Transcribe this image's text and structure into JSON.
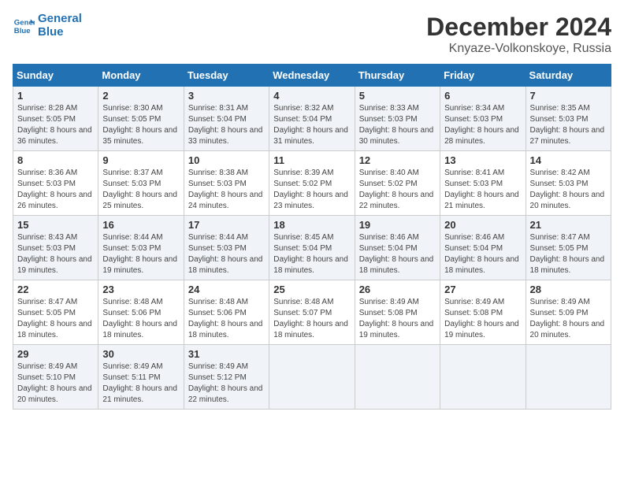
{
  "logo": {
    "line1": "General",
    "line2": "Blue"
  },
  "title": "December 2024",
  "location": "Knyaze-Volkonskoye, Russia",
  "days_of_week": [
    "Sunday",
    "Monday",
    "Tuesday",
    "Wednesday",
    "Thursday",
    "Friday",
    "Saturday"
  ],
  "weeks": [
    [
      {
        "day": "1",
        "sunrise": "8:28 AM",
        "sunset": "5:05 PM",
        "daylight": "8 hours and 36 minutes."
      },
      {
        "day": "2",
        "sunrise": "8:30 AM",
        "sunset": "5:05 PM",
        "daylight": "8 hours and 35 minutes."
      },
      {
        "day": "3",
        "sunrise": "8:31 AM",
        "sunset": "5:04 PM",
        "daylight": "8 hours and 33 minutes."
      },
      {
        "day": "4",
        "sunrise": "8:32 AM",
        "sunset": "5:04 PM",
        "daylight": "8 hours and 31 minutes."
      },
      {
        "day": "5",
        "sunrise": "8:33 AM",
        "sunset": "5:03 PM",
        "daylight": "8 hours and 30 minutes."
      },
      {
        "day": "6",
        "sunrise": "8:34 AM",
        "sunset": "5:03 PM",
        "daylight": "8 hours and 28 minutes."
      },
      {
        "day": "7",
        "sunrise": "8:35 AM",
        "sunset": "5:03 PM",
        "daylight": "8 hours and 27 minutes."
      }
    ],
    [
      {
        "day": "8",
        "sunrise": "8:36 AM",
        "sunset": "5:03 PM",
        "daylight": "8 hours and 26 minutes."
      },
      {
        "day": "9",
        "sunrise": "8:37 AM",
        "sunset": "5:03 PM",
        "daylight": "8 hours and 25 minutes."
      },
      {
        "day": "10",
        "sunrise": "8:38 AM",
        "sunset": "5:03 PM",
        "daylight": "8 hours and 24 minutes."
      },
      {
        "day": "11",
        "sunrise": "8:39 AM",
        "sunset": "5:02 PM",
        "daylight": "8 hours and 23 minutes."
      },
      {
        "day": "12",
        "sunrise": "8:40 AM",
        "sunset": "5:02 PM",
        "daylight": "8 hours and 22 minutes."
      },
      {
        "day": "13",
        "sunrise": "8:41 AM",
        "sunset": "5:03 PM",
        "daylight": "8 hours and 21 minutes."
      },
      {
        "day": "14",
        "sunrise": "8:42 AM",
        "sunset": "5:03 PM",
        "daylight": "8 hours and 20 minutes."
      }
    ],
    [
      {
        "day": "15",
        "sunrise": "8:43 AM",
        "sunset": "5:03 PM",
        "daylight": "8 hours and 19 minutes."
      },
      {
        "day": "16",
        "sunrise": "8:44 AM",
        "sunset": "5:03 PM",
        "daylight": "8 hours and 19 minutes."
      },
      {
        "day": "17",
        "sunrise": "8:44 AM",
        "sunset": "5:03 PM",
        "daylight": "8 hours and 18 minutes."
      },
      {
        "day": "18",
        "sunrise": "8:45 AM",
        "sunset": "5:04 PM",
        "daylight": "8 hours and 18 minutes."
      },
      {
        "day": "19",
        "sunrise": "8:46 AM",
        "sunset": "5:04 PM",
        "daylight": "8 hours and 18 minutes."
      },
      {
        "day": "20",
        "sunrise": "8:46 AM",
        "sunset": "5:04 PM",
        "daylight": "8 hours and 18 minutes."
      },
      {
        "day": "21",
        "sunrise": "8:47 AM",
        "sunset": "5:05 PM",
        "daylight": "8 hours and 18 minutes."
      }
    ],
    [
      {
        "day": "22",
        "sunrise": "8:47 AM",
        "sunset": "5:05 PM",
        "daylight": "8 hours and 18 minutes."
      },
      {
        "day": "23",
        "sunrise": "8:48 AM",
        "sunset": "5:06 PM",
        "daylight": "8 hours and 18 minutes."
      },
      {
        "day": "24",
        "sunrise": "8:48 AM",
        "sunset": "5:06 PM",
        "daylight": "8 hours and 18 minutes."
      },
      {
        "day": "25",
        "sunrise": "8:48 AM",
        "sunset": "5:07 PM",
        "daylight": "8 hours and 18 minutes."
      },
      {
        "day": "26",
        "sunrise": "8:49 AM",
        "sunset": "5:08 PM",
        "daylight": "8 hours and 19 minutes."
      },
      {
        "day": "27",
        "sunrise": "8:49 AM",
        "sunset": "5:08 PM",
        "daylight": "8 hours and 19 minutes."
      },
      {
        "day": "28",
        "sunrise": "8:49 AM",
        "sunset": "5:09 PM",
        "daylight": "8 hours and 20 minutes."
      }
    ],
    [
      {
        "day": "29",
        "sunrise": "8:49 AM",
        "sunset": "5:10 PM",
        "daylight": "8 hours and 20 minutes."
      },
      {
        "day": "30",
        "sunrise": "8:49 AM",
        "sunset": "5:11 PM",
        "daylight": "8 hours and 21 minutes."
      },
      {
        "day": "31",
        "sunrise": "8:49 AM",
        "sunset": "5:12 PM",
        "daylight": "8 hours and 22 minutes."
      },
      null,
      null,
      null,
      null
    ]
  ],
  "labels": {
    "sunrise": "Sunrise:",
    "sunset": "Sunset:",
    "daylight": "Daylight:"
  }
}
